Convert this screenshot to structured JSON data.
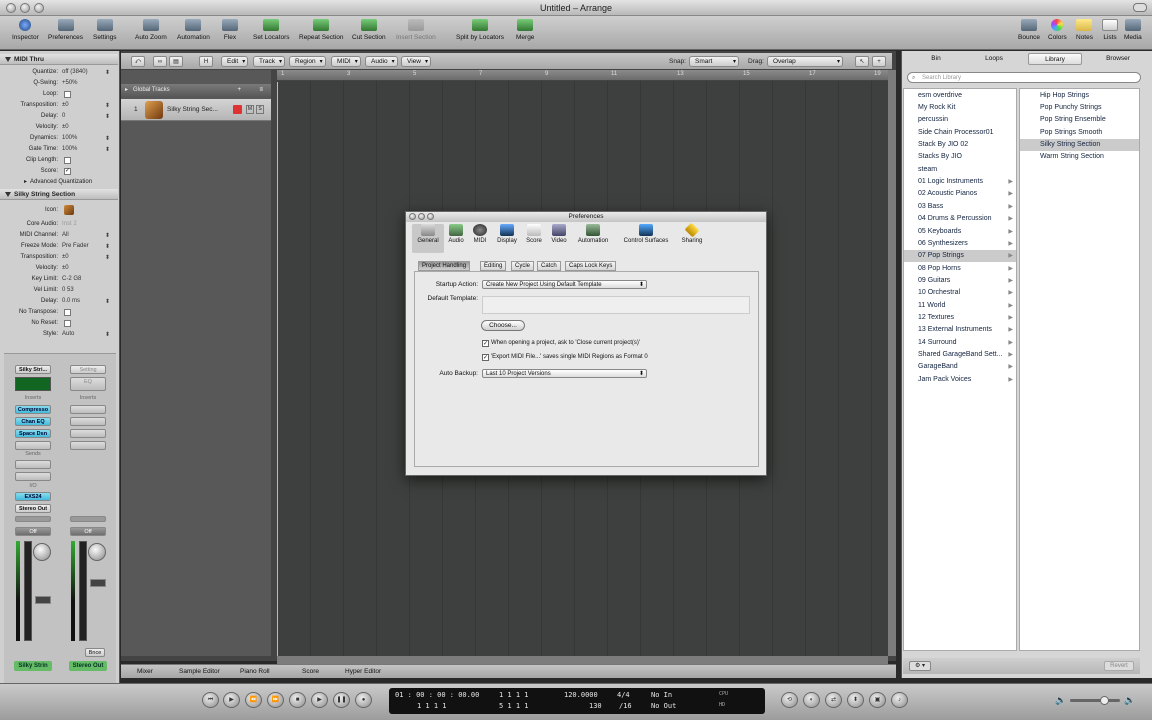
{
  "window": {
    "title": "Untitled – Arrange"
  },
  "toolbar": {
    "left": [
      "Inspector",
      "Preferences",
      "Settings"
    ],
    "center": [
      "Auto Zoom",
      "Automation",
      "Flex",
      "Set Locators",
      "Repeat Section",
      "Cut Section",
      "Insert Section",
      "Split by Locators",
      "Merge"
    ],
    "right": [
      "Bounce",
      "Colors",
      "Notes",
      "Lists",
      "Media"
    ]
  },
  "inspector": {
    "header1": "MIDI Thru",
    "region_params": [
      {
        "label": "Quantize:",
        "value": "off (3840)"
      },
      {
        "label": "Q-Swing:",
        "value": "+50%"
      },
      {
        "label": "Loop:",
        "value": ""
      },
      {
        "label": "Transposition:",
        "value": "±0"
      },
      {
        "label": "Delay:",
        "value": "0"
      },
      {
        "label": "Velocity:",
        "value": "±0"
      },
      {
        "label": "Dynamics:",
        "value": "100%"
      },
      {
        "label": "Gate Time:",
        "value": "100%"
      },
      {
        "label": "Clip Length:",
        "value": ""
      },
      {
        "label": "Score:",
        "value": ""
      }
    ],
    "advanced": "Advanced Quantization",
    "header2": "Silky String Section",
    "track_params": [
      {
        "label": "Icon:",
        "value": ""
      },
      {
        "label": "Core Audio:",
        "value": "Inst 2"
      },
      {
        "label": "MIDI Channel:",
        "value": "All"
      },
      {
        "label": "Freeze Mode:",
        "value": "Pre Fader"
      },
      {
        "label": "Transposition:",
        "value": "±0"
      },
      {
        "label": "Velocity:",
        "value": "±0"
      },
      {
        "label": "Key Limit:",
        "value": "C-2   G8"
      },
      {
        "label": "Vel Limit:",
        "value": "0     53"
      },
      {
        "label": "Delay:",
        "value": "0.0 ms"
      },
      {
        "label": "No Transpose:",
        "value": ""
      },
      {
        "label": "No Reset:",
        "value": ""
      },
      {
        "label": "Style:",
        "value": "Auto"
      }
    ],
    "strip1": {
      "name": "Silky Stri...",
      "inserts_label": "Inserts",
      "inserts": [
        "Compresso",
        "Chan EQ",
        "Space Dsn"
      ],
      "sends_label": "Sends",
      "io_label": "I/O",
      "input": "EXS24",
      "output": "Stereo Out",
      "auto": "Off",
      "footer": "Silky Strin"
    },
    "strip2": {
      "setting": "Setting",
      "eq": "EQ",
      "inserts_label": "Inserts",
      "auto": "Off",
      "footer": "Stereo Out",
      "bnce": "Bnce"
    }
  },
  "arrange": {
    "menus": [
      "Edit",
      "Track",
      "Region",
      "MIDI",
      "Audio",
      "View"
    ],
    "snap_label": "Snap:",
    "snap": "Smart",
    "drag_label": "Drag:",
    "drag": "Overlap",
    "ruler": [
      "1",
      "3",
      "5",
      "7",
      "9",
      "11",
      "13",
      "15",
      "17",
      "19"
    ],
    "global_tracks": "Global Tracks",
    "track": {
      "num": "1",
      "name": "Silky String Sec..."
    },
    "bottom_tabs": [
      "Mixer",
      "Sample Editor",
      "Piano Roll",
      "Score",
      "Hyper Editor"
    ]
  },
  "library": {
    "tabs": [
      "Bin",
      "Loops",
      "Library",
      "Browser"
    ],
    "search_placeholder": "Search Library",
    "col1": [
      "esm overdrive",
      "My Rock Kit",
      "percussin",
      "Side Chain Processor01",
      "Stack By JIO 02",
      "Stacks By JIO",
      "steam",
      "01 Logic Instruments",
      "02 Acoustic Pianos",
      "03 Bass",
      "04 Drums & Percussion",
      "06 Synthesizers",
      "05 Keyboards",
      "07 Pop Strings",
      "08 Pop Horns",
      "09 Guitars",
      "10 Orchestral",
      "11 World",
      "12 Textures",
      "13 External Instruments",
      "14 Surround",
      "Shared GarageBand Sett...",
      "GarageBand",
      "Jam Pack Voices"
    ],
    "col2": [
      "Hip Hop Strings",
      "Pop Punchy Strings",
      "Pop String Ensemble",
      "Pop Strings Smooth",
      "Silky String Section",
      "Warm String Section"
    ],
    "revert": "Revert"
  },
  "transport": {
    "time": "01 : 00 : 00 : 00.00",
    "bar_top": "1    1    1    1",
    "bar_bottom": "1    1    1    1",
    "pos_top": "1    1    1    1",
    "pos_bottom": "5    1    1    1",
    "tempo": "120.0000",
    "tempo2": "130",
    "sig": "4/4",
    "div": "/16",
    "in": "No In",
    "out": "No Out",
    "cpu": "CPU",
    "hd": "HD"
  },
  "preferences": {
    "title": "Preferences",
    "tabs": [
      "General",
      "Audio",
      "MIDI",
      "Display",
      "Score",
      "Video",
      "Automation",
      "Control Surfaces",
      "Sharing"
    ],
    "subtabs": [
      "Project Handling",
      "Editing",
      "Cycle",
      "Catch",
      "Caps Lock Keys"
    ],
    "startup_label": "Startup Action:",
    "startup_value": "Create New Project Using Default Template",
    "template_label": "Default Template:",
    "choose": "Choose...",
    "check1": "When opening a project, ask to 'Close current project(s)'",
    "check2": "'Export MIDI File...' saves single MIDI Regions as Format 0",
    "backup_label": "Auto Backup:",
    "backup_value": "Last 10 Project Versions"
  }
}
